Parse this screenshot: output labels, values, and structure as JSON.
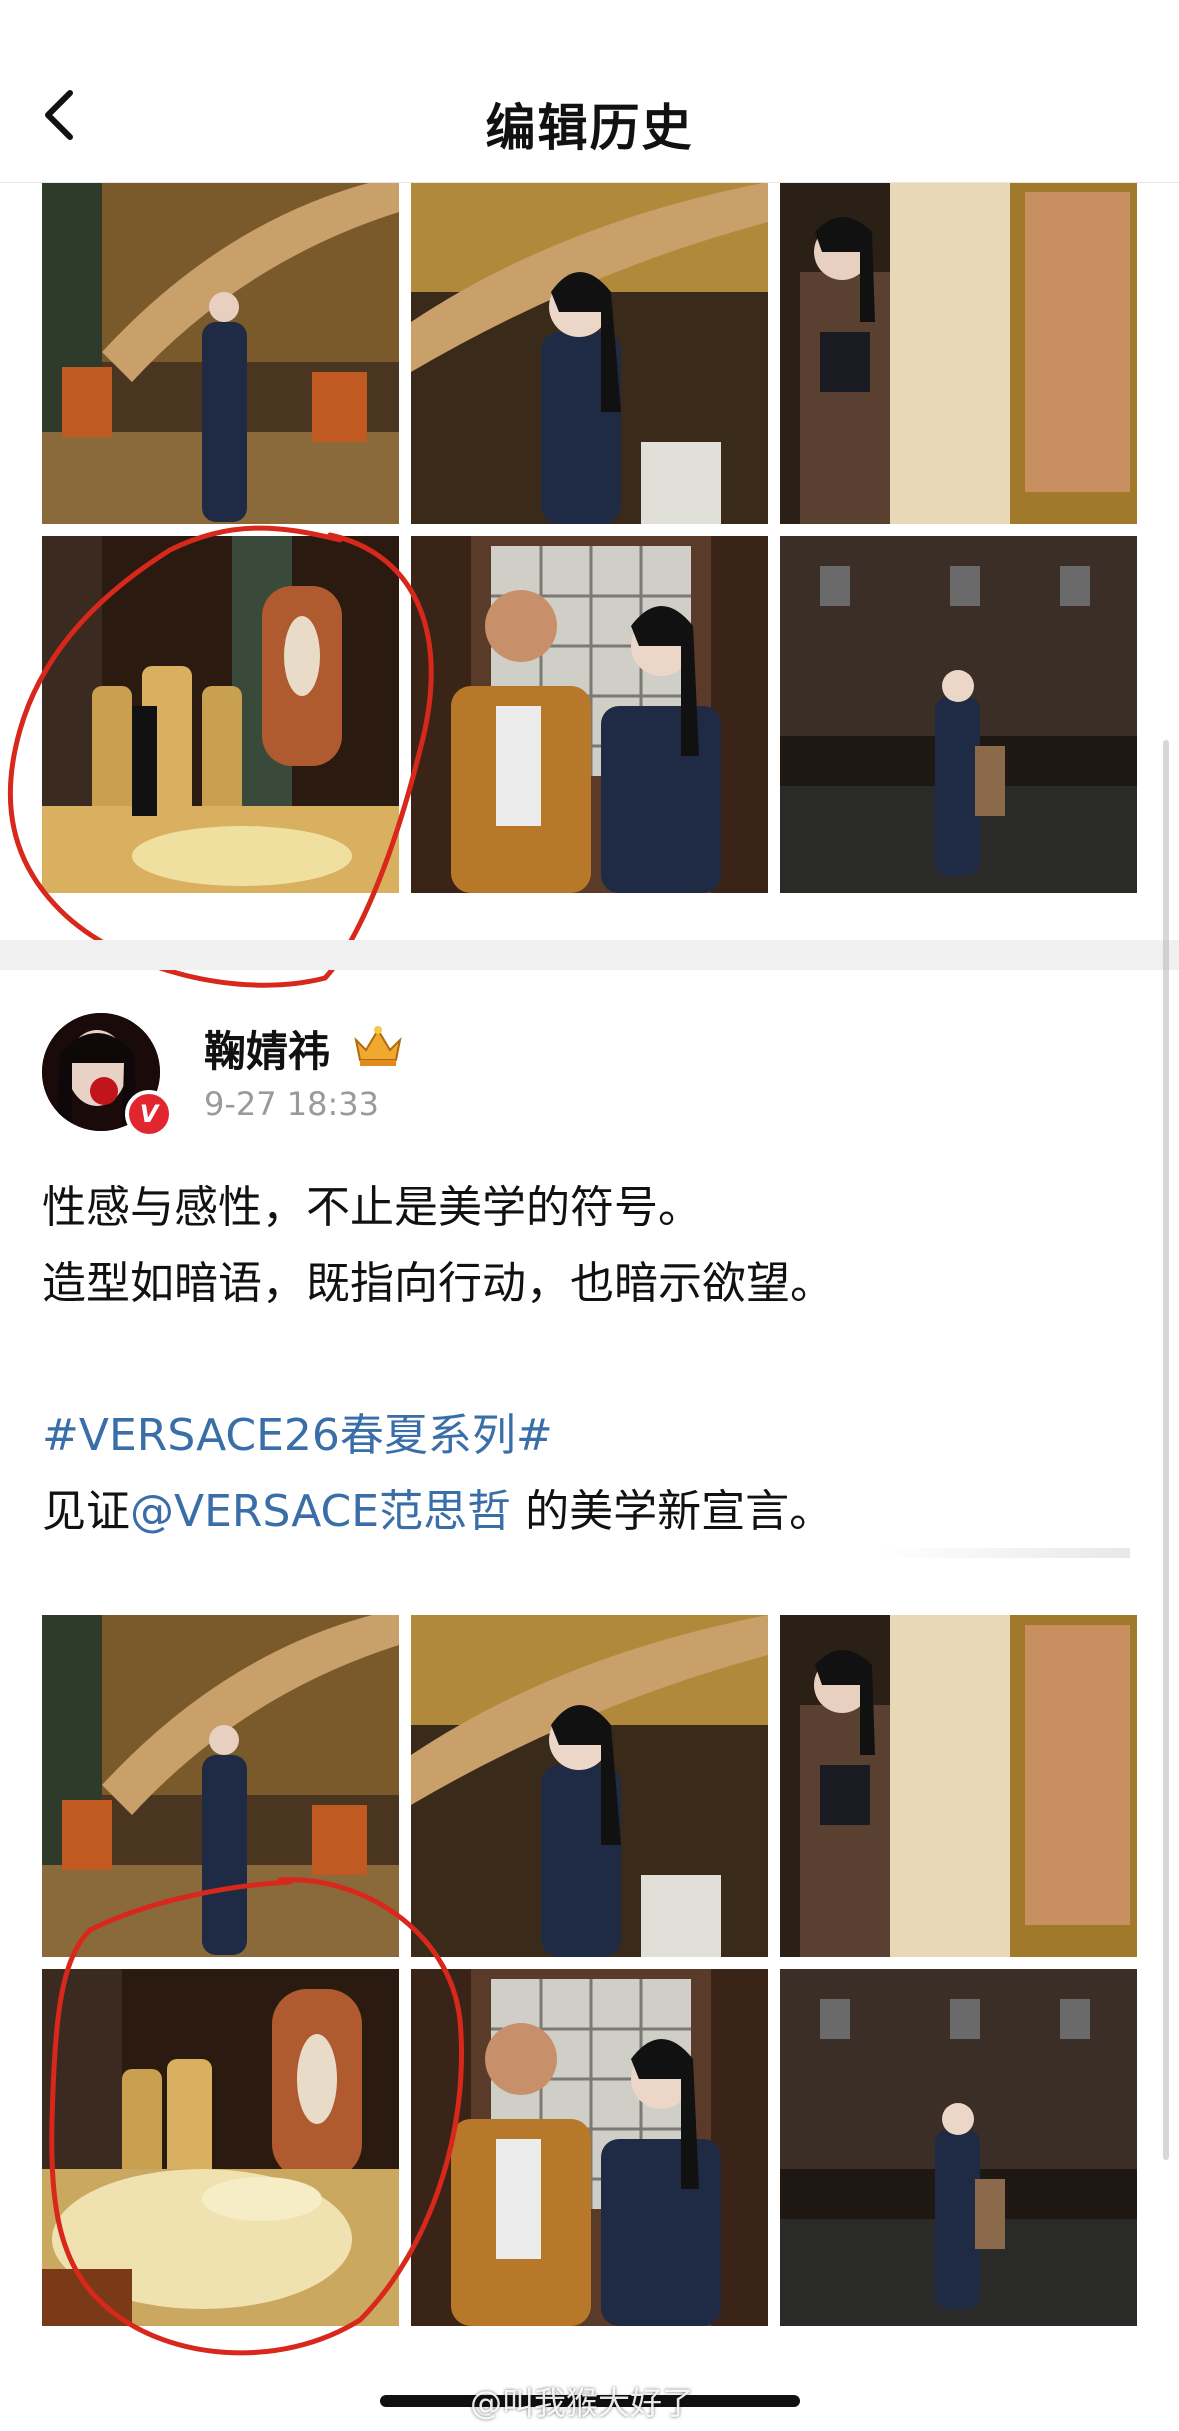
{
  "header": {
    "title": "编辑历史",
    "back_icon": "chevron-left-icon"
  },
  "user": {
    "name": "鞠婧祎",
    "badge_icon": "crown-badge-icon",
    "verified_mark": "V",
    "time": "9-27 18:33"
  },
  "post": {
    "line1": "性感与感性，不止是美学的符号。",
    "line2": "造型如暗语，既指向行动，也暗示欲望。",
    "hashtag": "#VERSACE26春夏系列#",
    "line4_prefix": "见证",
    "mention": "@VERSACE范思哲",
    "line4_suffix": " 的美学新宣言。"
  },
  "watermark": "@叫我猴大好了",
  "colors": {
    "link": "#3a6ea8",
    "annotation_red": "#d8281c",
    "verified": "#e2262f",
    "separator": "#f0f0f0"
  }
}
